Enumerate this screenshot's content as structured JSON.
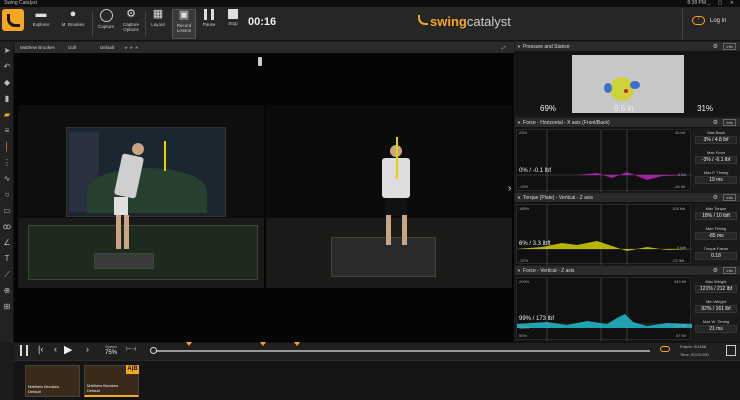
{
  "window": {
    "title": "Swing Catalyst",
    "clock": "8:38 PM",
    "controls": "_ ▢ ✕"
  },
  "toolbar": {
    "explorer": "Explorer",
    "user": "M. Brookes",
    "capture": "Capture",
    "capture_options": "Capture Options",
    "layout": "Layout",
    "record_lesson": "Record Lesson",
    "pause": "Pause",
    "stop": "Stop",
    "timer": "00:16",
    "brand_swing": "swing",
    "brand_catalyst": "catalyst",
    "login": "Log in"
  },
  "video_header": {
    "player": "Matthew Brookes",
    "sport": "Golf",
    "preset": "Default",
    "rating": "★ ★ ★"
  },
  "panels": {
    "pressure": {
      "title": "Pressure and Stance",
      "left_pct": "69%",
      "width": "9.5 in",
      "right_pct": "31%",
      "info": "Info"
    },
    "force_h": {
      "title": "Force - Horizontal - X axis (Front/Back)",
      "info": "Info",
      "top_left": "23%",
      "top_right": "40 lbf",
      "main": "0% / -0.1 lbf",
      "zero_r": "0 lbf",
      "bot_left": "-23%",
      "bot_right": "-40 lbf",
      "m1_label": "Max Back",
      "m1_value": "3% / 4.8 lbf",
      "m2_label": "Max Front",
      "m2_value": "-3% / -6.1 lbf",
      "m3_label": "Max F. Timing",
      "m3_value": "19 ms"
    },
    "torque": {
      "title": "Torque (Plate) - Vertical - Z axis",
      "info": "Info",
      "top_left": "185%",
      "top_right": "108 lbft",
      "main": "6% / 3.3 lbft",
      "zero_r": "0 lbft",
      "bot_left": "-37%",
      "bot_right": "-22 lbft",
      "m1_label": "Max Torque",
      "m1_value": "18% / 10 lbft",
      "m2_label": "Max Timing",
      "m2_value": "-85 ms",
      "m3_label": "Torque Factor",
      "m3_value": "0.18"
    },
    "force_v": {
      "title": "Force - Vertical - Z axis",
      "info": "Info",
      "top_left": "200%",
      "top_right": "349 lbf",
      "main": "99% / 173 lbf",
      "mid_left": "100%",
      "mid_right": "174 lbf",
      "bot_left": "50%",
      "bot_right": "87 lbf",
      "m1_label": "Max Weight",
      "m1_value": "121% / 212 lbf",
      "m2_label": "Min Weight",
      "m2_value": "92% / 161 lbf",
      "m3_label": "Max W. Timing",
      "m3_value": "21 ms"
    }
  },
  "timeline": {
    "speed_label": "Speed",
    "speed_value": "75%",
    "frame_label": "Frame:",
    "frame_value": "0/1456",
    "time_label": "Time:",
    "time_value": "00:00:000"
  },
  "sessions": [
    {
      "name": "Matthew Brookes",
      "preset": "Default"
    },
    {
      "name": "Matthew Brookes",
      "preset": "Default"
    }
  ],
  "ab_badge": "A|B",
  "colors": {
    "accent": "#f5a623",
    "magenta": "#cc22cc",
    "yellow": "#d4d400",
    "cyan": "#22bbcc"
  }
}
